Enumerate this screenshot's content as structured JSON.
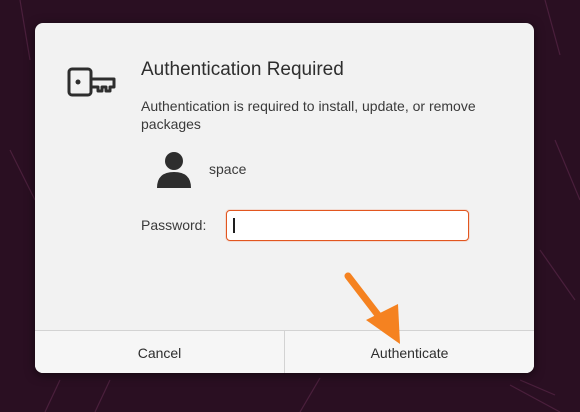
{
  "dialog": {
    "title": "Authentication Required",
    "message": "Authentication is required to install, update, or remove packages",
    "username": "space",
    "password_label": "Password:",
    "password_value": "",
    "cancel_label": "Cancel",
    "authenticate_label": "Authenticate"
  },
  "icons": {
    "key": "key-icon",
    "user": "user-avatar-icon",
    "annotation": "arrow-pointer-icon"
  },
  "colors": {
    "accent": "#e95420",
    "annotation_arrow": "#f58220",
    "background": "#2a0f22"
  }
}
